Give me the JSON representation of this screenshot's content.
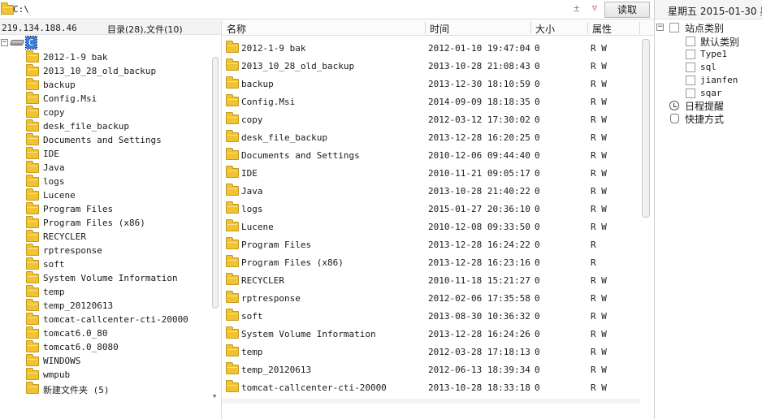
{
  "path_bar": {
    "path": "C:\\",
    "pm_glyph": "±",
    "dropdown_glyph": "▽",
    "read_button": "读取"
  },
  "left_panel": {
    "ip": "219.134.188.46",
    "summary": "目录(28),文件(10)",
    "drive_label": "C",
    "tree_items": [
      "2012-1-9 bak",
      "2013_10_28_old_backup",
      "backup",
      "Config.Msi",
      "copy",
      "desk_file_backup",
      "Documents and Settings",
      "IDE",
      "Java",
      "logs",
      "Lucene",
      "Program Files",
      "Program Files (x86)",
      "RECYCLER",
      "rptresponse",
      "soft",
      "System Volume Information",
      "temp",
      "temp_20120613",
      "tomcat-callcenter-cti-20000",
      "tomcat6.0_80",
      "tomcat6.0_8080",
      "WINDOWS",
      "wmpub",
      "新建文件夹 (5)"
    ]
  },
  "file_list": {
    "columns": {
      "name": "名称",
      "time": "时间",
      "size": "大小",
      "attr": "属性"
    },
    "rows": [
      {
        "name": "2012-1-9 bak",
        "time": "2012-01-10 19:47:04",
        "size": "0",
        "attr": "R W"
      },
      {
        "name": "2013_10_28_old_backup",
        "time": "2013-10-28 21:08:43",
        "size": "0",
        "attr": "R W"
      },
      {
        "name": "backup",
        "time": "2013-12-30 18:10:59",
        "size": "0",
        "attr": "R W"
      },
      {
        "name": "Config.Msi",
        "time": "2014-09-09 18:18:35",
        "size": "0",
        "attr": "R W"
      },
      {
        "name": "copy",
        "time": "2012-03-12 17:30:02",
        "size": "0",
        "attr": "R W"
      },
      {
        "name": "desk_file_backup",
        "time": "2013-12-28 16:20:25",
        "size": "0",
        "attr": "R W"
      },
      {
        "name": "Documents and Settings",
        "time": "2010-12-06 09:44:40",
        "size": "0",
        "attr": "R W"
      },
      {
        "name": "IDE",
        "time": "2010-11-21 09:05:17",
        "size": "0",
        "attr": "R W"
      },
      {
        "name": "Java",
        "time": "2013-10-28 21:40:22",
        "size": "0",
        "attr": "R W"
      },
      {
        "name": "logs",
        "time": "2015-01-27 20:36:10",
        "size": "0",
        "attr": "R W"
      },
      {
        "name": "Lucene",
        "time": "2010-12-08 09:33:50",
        "size": "0",
        "attr": "R W"
      },
      {
        "name": "Program Files",
        "time": "2013-12-28 16:24:22",
        "size": "0",
        "attr": "R"
      },
      {
        "name": "Program Files (x86)",
        "time": "2013-12-28 16:23:16",
        "size": "0",
        "attr": "R"
      },
      {
        "name": "RECYCLER",
        "time": "2010-11-18 15:21:27",
        "size": "0",
        "attr": "R W"
      },
      {
        "name": "rptresponse",
        "time": "2012-02-06 17:35:58",
        "size": "0",
        "attr": "R W"
      },
      {
        "name": "soft",
        "time": "2013-08-30 10:36:32",
        "size": "0",
        "attr": "R W"
      },
      {
        "name": "System Volume Information",
        "time": "2013-12-28 16:24:26",
        "size": "0",
        "attr": "R W"
      },
      {
        "name": "temp",
        "time": "2012-03-28 17:18:13",
        "size": "0",
        "attr": "R W"
      },
      {
        "name": "temp_20120613",
        "time": "2012-06-13 18:39:34",
        "size": "0",
        "attr": "R W"
      },
      {
        "name": "tomcat-callcenter-cti-20000",
        "time": "2013-10-28 18:33:18",
        "size": "0",
        "attr": "R W"
      }
    ]
  },
  "right_panel": {
    "date": "星期五  2015-01-30 星",
    "site_category": "站点类别",
    "sites": [
      "默认类别",
      "Type1",
      "sql",
      "jianfen",
      "sqar"
    ],
    "schedule": "日程提醒",
    "shortcut": "快捷方式"
  },
  "colors": {
    "folder": "#f1c232",
    "folder_border": "#c49a1c",
    "selection": "#3a7bd5",
    "dropdown_arrow": "#c23a3a"
  }
}
